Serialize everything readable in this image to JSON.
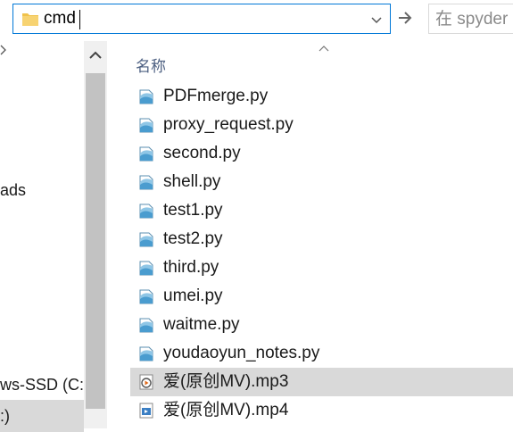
{
  "address": {
    "path": "cmd"
  },
  "search": {
    "placeholder": "在 spyder"
  },
  "nav": {
    "items": [
      {
        "label": "ads"
      },
      {
        "label": "ws-SSD (C:)"
      },
      {
        "label": ":)"
      }
    ]
  },
  "list": {
    "column_name": "名称",
    "files": [
      {
        "name": "PDFmerge.py",
        "type": "py"
      },
      {
        "name": "proxy_request.py",
        "type": "py"
      },
      {
        "name": "second.py",
        "type": "py"
      },
      {
        "name": "shell.py",
        "type": "py"
      },
      {
        "name": "test1.py",
        "type": "py"
      },
      {
        "name": "test2.py",
        "type": "py"
      },
      {
        "name": "third.py",
        "type": "py"
      },
      {
        "name": "umei.py",
        "type": "py"
      },
      {
        "name": "waitme.py",
        "type": "py"
      },
      {
        "name": "youdaoyun_notes.py",
        "type": "py"
      },
      {
        "name": "爱(原创MV).mp3",
        "type": "mp3",
        "selected": true
      },
      {
        "name": "爱(原创MV).mp4",
        "type": "mp4"
      }
    ]
  },
  "colors": {
    "accent": "#0078d7",
    "selection": "#d9d9d9",
    "column_header": "#4d6082"
  }
}
